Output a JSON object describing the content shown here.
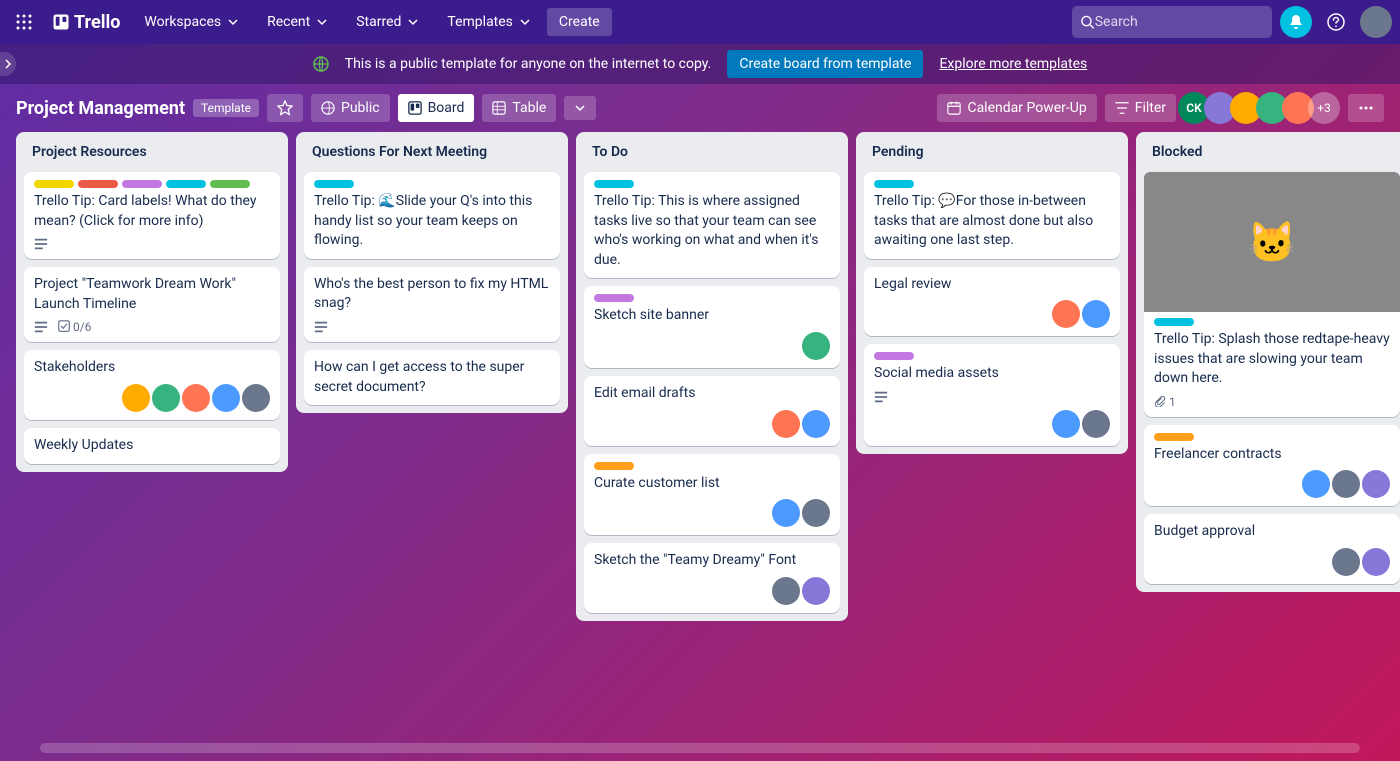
{
  "nav": {
    "brand": "Trello",
    "workspaces": "Workspaces",
    "recent": "Recent",
    "starred": "Starred",
    "templates": "Templates",
    "create": "Create",
    "search_placeholder": "Search"
  },
  "banner": {
    "text": "This is a public template for anyone on the internet to copy.",
    "create_btn": "Create board from template",
    "explore": "Explore more templates"
  },
  "board": {
    "title": "Project Management",
    "template_badge": "Template",
    "public": "Public",
    "view_board": "Board",
    "view_table": "Table",
    "calendar": "Calendar Power-Up",
    "filter": "Filter",
    "more_members": "+3"
  },
  "lists": [
    {
      "title": "Project Resources",
      "cards": [
        {
          "labels": [
            "yellow",
            "red",
            "purple",
            "sky",
            "green"
          ],
          "title": "Trello Tip: Card labels! What do they mean? (Click for more info)",
          "desc": true
        },
        {
          "title": "Project \"Teamwork Dream Work\" Launch Timeline",
          "desc": true,
          "checklist": "0/6"
        },
        {
          "title": "Stakeholders",
          "members": 5
        },
        {
          "title": "Weekly Updates"
        }
      ]
    },
    {
      "title": "Questions For Next Meeting",
      "cards": [
        {
          "labels": [
            "sky"
          ],
          "title": "Trello Tip: 🌊Slide your Q's into this handy list so your team keeps on flowing."
        },
        {
          "title": "Who's the best person to fix my HTML snag?",
          "desc": true
        },
        {
          "title": "How can I get access to the super secret document?"
        }
      ]
    },
    {
      "title": "To Do",
      "cards": [
        {
          "labels": [
            "sky"
          ],
          "title": "Trello Tip: This is where assigned tasks live so that your team can see who's working on what and when it's due."
        },
        {
          "labels": [
            "purple"
          ],
          "title": "Sketch site banner",
          "members": 1
        },
        {
          "title": "Edit email drafts",
          "members": 2
        },
        {
          "labels": [
            "orange"
          ],
          "title": "Curate customer list",
          "members": 2
        },
        {
          "title": "Sketch the \"Teamy Dreamy\" Font",
          "members": 2
        }
      ]
    },
    {
      "title": "Pending",
      "cards": [
        {
          "labels": [
            "sky"
          ],
          "title": "Trello Tip: 💬For those in-between tasks that are almost done but also awaiting one last step."
        },
        {
          "title": "Legal review",
          "members": 2
        },
        {
          "labels": [
            "purple"
          ],
          "title": "Social media assets",
          "desc": true,
          "members": 2
        }
      ]
    },
    {
      "title": "Blocked",
      "cards": [
        {
          "cover": true,
          "labels": [
            "sky"
          ],
          "title": "Trello Tip: Splash those redtape-heavy issues that are slowing your team down here.",
          "attachment": "1"
        },
        {
          "labels": [
            "orange"
          ],
          "title": "Freelancer contracts",
          "members": 3
        },
        {
          "title": "Budget approval",
          "members": 2
        }
      ]
    }
  ]
}
